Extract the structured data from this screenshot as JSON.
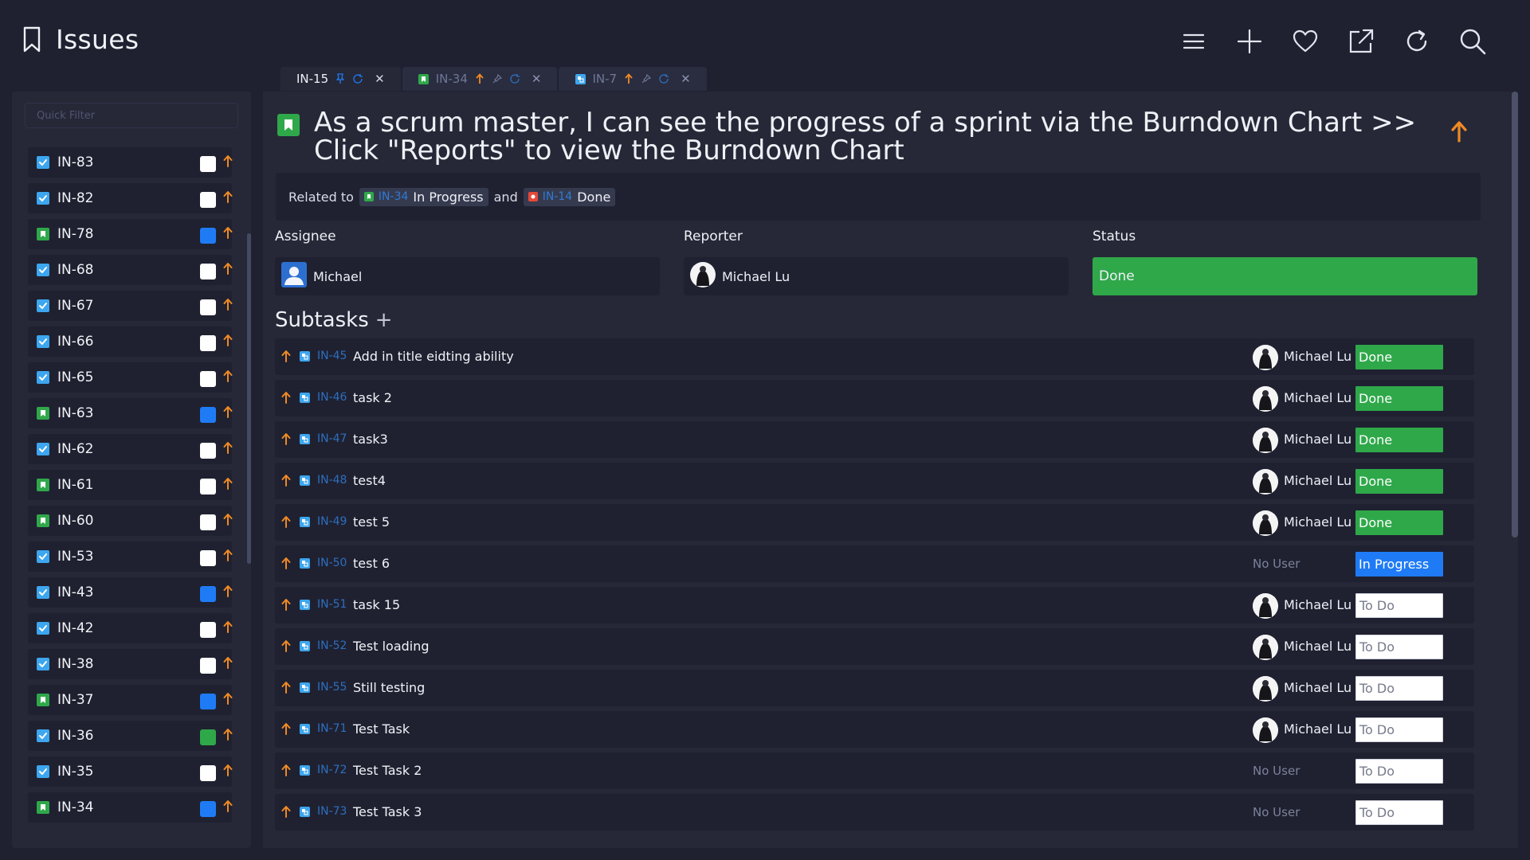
{
  "header": {
    "title": "Issues"
  },
  "toolbar": [
    {
      "name": "menu-icon"
    },
    {
      "name": "plus-icon"
    },
    {
      "name": "heart-icon"
    },
    {
      "name": "external-link-icon"
    },
    {
      "name": "refresh-icon"
    },
    {
      "name": "search-icon"
    }
  ],
  "tabs": [
    {
      "label": "IN-15",
      "type": "subtask",
      "active": true
    },
    {
      "label": "IN-34",
      "type": "story",
      "active": false
    },
    {
      "label": "IN-7",
      "type": "subtask",
      "active": false
    }
  ],
  "sidebar": {
    "filter_placeholder": "Quick Filter",
    "items": [
      {
        "key": "IN-83",
        "type": "task",
        "swatch": "#ffffff"
      },
      {
        "key": "IN-82",
        "type": "task",
        "swatch": "#ffffff"
      },
      {
        "key": "IN-78",
        "type": "story",
        "swatch": "#1f7bf5"
      },
      {
        "key": "IN-68",
        "type": "task",
        "swatch": "#ffffff"
      },
      {
        "key": "IN-67",
        "type": "task",
        "swatch": "#ffffff"
      },
      {
        "key": "IN-66",
        "type": "task",
        "swatch": "#ffffff"
      },
      {
        "key": "IN-65",
        "type": "task",
        "swatch": "#ffffff"
      },
      {
        "key": "IN-63",
        "type": "story",
        "swatch": "#1f7bf5"
      },
      {
        "key": "IN-62",
        "type": "task",
        "swatch": "#ffffff"
      },
      {
        "key": "IN-61",
        "type": "story",
        "swatch": "#ffffff"
      },
      {
        "key": "IN-60",
        "type": "story",
        "swatch": "#ffffff"
      },
      {
        "key": "IN-53",
        "type": "task",
        "swatch": "#ffffff"
      },
      {
        "key": "IN-43",
        "type": "task",
        "swatch": "#1f7bf5"
      },
      {
        "key": "IN-42",
        "type": "task",
        "swatch": "#ffffff"
      },
      {
        "key": "IN-38",
        "type": "task",
        "swatch": "#ffffff"
      },
      {
        "key": "IN-37",
        "type": "story",
        "swatch": "#1f7bf5"
      },
      {
        "key": "IN-36",
        "type": "task",
        "swatch": "#2fa84a"
      },
      {
        "key": "IN-35",
        "type": "task",
        "swatch": "#ffffff"
      },
      {
        "key": "IN-34",
        "type": "story",
        "swatch": "#1f7bf5"
      }
    ]
  },
  "issue": {
    "title": "As a scrum master, I can see the progress of a sprint via the Burndown Chart >> Click \"Reports\" to view the Burndown Chart",
    "related": {
      "prefix": "Related to",
      "first": {
        "key": "IN-34",
        "status": "In Progress"
      },
      "joiner": "and",
      "second": {
        "key": "IN-14",
        "status": "Done"
      }
    },
    "assignee_label": "Assignee",
    "assignee": "Michael",
    "reporter_label": "Reporter",
    "reporter": "Michael Lu",
    "status_label": "Status",
    "status": "Done"
  },
  "subtasks": {
    "heading": "Subtasks",
    "add": "+",
    "items": [
      {
        "key": "IN-45",
        "name": "Add in title eidting ability",
        "user": "Michael Lu",
        "status": "Done",
        "state": "done"
      },
      {
        "key": "IN-46",
        "name": "task 2",
        "user": "Michael Lu",
        "status": "Done",
        "state": "done"
      },
      {
        "key": "IN-47",
        "name": "task3",
        "user": "Michael Lu",
        "status": "Done",
        "state": "done"
      },
      {
        "key": "IN-48",
        "name": "test4",
        "user": "Michael Lu",
        "status": "Done",
        "state": "done"
      },
      {
        "key": "IN-49",
        "name": "test 5",
        "user": "Michael Lu",
        "status": "Done",
        "state": "done"
      },
      {
        "key": "IN-50",
        "name": "test 6",
        "user": "No User",
        "status": "In Progress",
        "state": "progress"
      },
      {
        "key": "IN-51",
        "name": "task 15",
        "user": "Michael Lu",
        "status": "To Do",
        "state": "todo"
      },
      {
        "key": "IN-52",
        "name": "Test loading",
        "user": "Michael Lu",
        "status": "To Do",
        "state": "todo"
      },
      {
        "key": "IN-55",
        "name": "Still testing",
        "user": "Michael Lu",
        "status": "To Do",
        "state": "todo"
      },
      {
        "key": "IN-71",
        "name": "Test Task",
        "user": "Michael Lu",
        "status": "To Do",
        "state": "todo"
      },
      {
        "key": "IN-72",
        "name": "Test Task 2",
        "user": "No User",
        "status": "To Do",
        "state": "todo"
      },
      {
        "key": "IN-73",
        "name": "Test Task 3",
        "user": "No User",
        "status": "To Do",
        "state": "todo"
      }
    ]
  }
}
